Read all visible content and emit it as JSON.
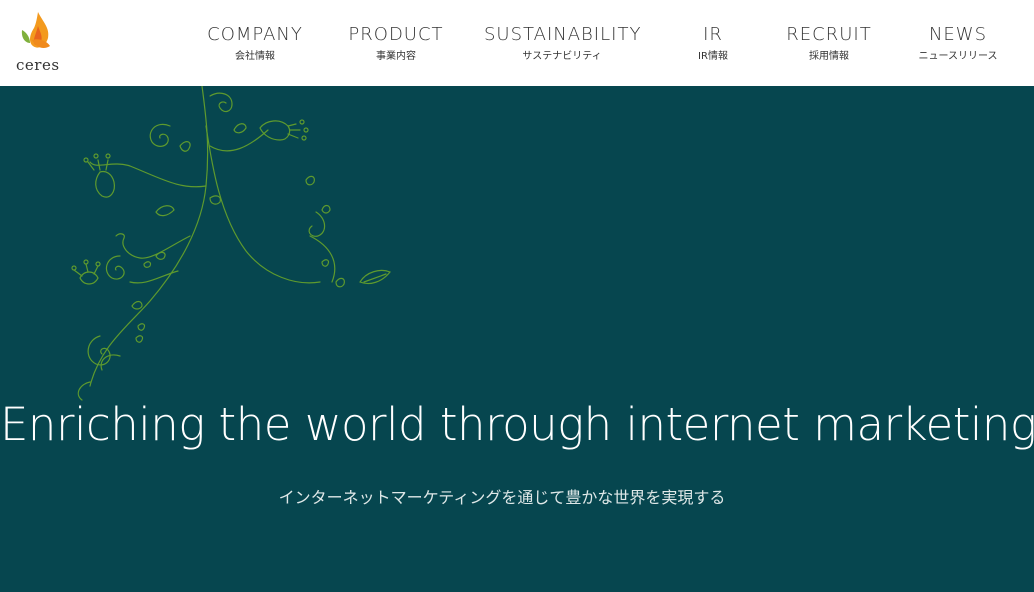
{
  "brand": {
    "logo_text": "ceres",
    "colors": {
      "flame_orange": "#f39a1e",
      "flame_red": "#e8641e",
      "leaf_green": "#7fb03c",
      "hero_bg": "#06464f",
      "vine_green": "#5e9a2e"
    }
  },
  "nav": {
    "items": [
      {
        "en": "COMPANY",
        "jp": "会社情報"
      },
      {
        "en": "PRODUCT",
        "jp": "事業内容"
      },
      {
        "en": "SUSTAINABILITY",
        "jp": "サステナビリティ"
      },
      {
        "en": "IR",
        "jp": "IR情報"
      },
      {
        "en": "RECRUIT",
        "jp": "採用情報"
      },
      {
        "en": "NEWS",
        "jp": "ニュースリリース"
      }
    ]
  },
  "hero": {
    "headline": "Enriching the world through internet marketing",
    "subline": "インターネットマーケティングを通じて豊かな世界を実現する",
    "decoration_icon": "botanical-vine-icon"
  }
}
